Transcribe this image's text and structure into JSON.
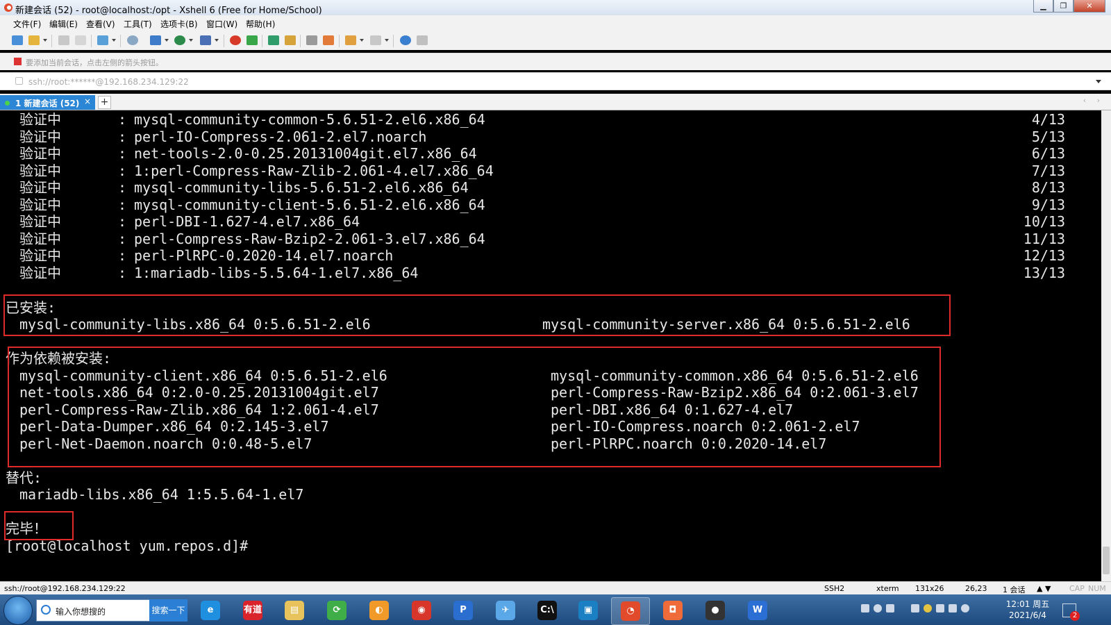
{
  "window": {
    "title": "新建会话 (52) - root@localhost:/opt - Xshell 6 (Free for Home/School)",
    "min": "▁",
    "max": "❐",
    "close": "✕"
  },
  "menu": [
    "文件(F)",
    "编辑(E)",
    "查看(V)",
    "工具(T)",
    "选项卡(B)",
    "窗口(W)",
    "帮助(H)"
  ],
  "hint": "要添加当前会话，点击左侧的箭头按钮。",
  "address": "ssh://root:******@192.168.234.129:22",
  "tab": {
    "label": "1 新建会话 (52)",
    "close": "×",
    "add": "+",
    "nav": "‹ ›"
  },
  "terminal": {
    "verify_label": "验证中",
    "colon": ":",
    "verify_rows": [
      {
        "pkg": "mysql-community-common-5.6.51-2.el6.x86_64",
        "num": "4/13"
      },
      {
        "pkg": "perl-IO-Compress-2.061-2.el7.noarch",
        "num": "5/13"
      },
      {
        "pkg": "net-tools-2.0-0.25.20131004git.el7.x86_64",
        "num": "6/13"
      },
      {
        "pkg": "1:perl-Compress-Raw-Zlib-2.061-4.el7.x86_64",
        "num": "7/13"
      },
      {
        "pkg": "mysql-community-libs-5.6.51-2.el6.x86_64",
        "num": "8/13"
      },
      {
        "pkg": "mysql-community-client-5.6.51-2.el6.x86_64",
        "num": "9/13"
      },
      {
        "pkg": "perl-DBI-1.627-4.el7.x86_64",
        "num": "10/13"
      },
      {
        "pkg": "perl-Compress-Raw-Bzip2-2.061-3.el7.x86_64",
        "num": "11/13"
      },
      {
        "pkg": "perl-PlRPC-0.2020-14.el7.noarch",
        "num": "12/13"
      },
      {
        "pkg": "1:mariadb-libs-5.5.64-1.el7.x86_64",
        "num": "13/13"
      }
    ],
    "installed_header": "已安装:",
    "installed": [
      "mysql-community-libs.x86_64 0:5.6.51-2.el6",
      "mysql-community-server.x86_64 0:5.6.51-2.el6"
    ],
    "deps_header": "作为依赖被安装:",
    "deps": [
      [
        "mysql-community-client.x86_64 0:5.6.51-2.el6",
        "mysql-community-common.x86_64 0:5.6.51-2.el6"
      ],
      [
        "net-tools.x86_64 0:2.0-0.25.20131004git.el7",
        "perl-Compress-Raw-Bzip2.x86_64 0:2.061-3.el7"
      ],
      [
        "perl-Compress-Raw-Zlib.x86_64 1:2.061-4.el7",
        "perl-DBI.x86_64 0:1.627-4.el7"
      ],
      [
        "perl-Data-Dumper.x86_64 0:2.145-3.el7",
        "perl-IO-Compress.noarch 0:2.061-2.el7"
      ],
      [
        "perl-Net-Daemon.noarch 0:0.48-5.el7",
        "perl-PlRPC.noarch 0:0.2020-14.el7"
      ]
    ],
    "replaced_header": "替代:",
    "replaced": "mariadb-libs.x86_64 1:5.5.64-1.el7",
    "complete": "完毕！",
    "prompt": "[root@localhost yum.repos.d]#"
  },
  "status": {
    "conn": "ssh://root@192.168.234.129:22",
    "proto": "SSH2",
    "term": "xterm",
    "size": "131x26",
    "cursor": "26,23",
    "sessions": "1 会话",
    "caps": "CAP",
    "num": "NUM"
  },
  "taskbar": {
    "search_placeholder": "输入你想搜的",
    "search_button": "搜索一下",
    "apps": [
      {
        "name": "ie-icon",
        "glyph": "e",
        "color": "#1f8fe0"
      },
      {
        "name": "youdao-icon",
        "glyph": "有道",
        "color": "#d9242b"
      },
      {
        "name": "file-explorer-icon",
        "glyph": "▤",
        "color": "#e8c25a"
      },
      {
        "name": "360-browser-icon",
        "glyph": "⟳",
        "color": "#3fae49"
      },
      {
        "name": "color-browser-icon",
        "glyph": "◐",
        "color": "#f19a2a"
      },
      {
        "name": "chrome-icon",
        "glyph": "◉",
        "color": "#d8362b"
      },
      {
        "name": "pycharm-icon",
        "glyph": "P",
        "color": "#2a6fd0"
      },
      {
        "name": "feishu-icon",
        "glyph": "✈",
        "color": "#5aa8e8"
      },
      {
        "name": "cmd-icon",
        "glyph": "C:\\",
        "color": "#111111"
      },
      {
        "name": "vmware-icon",
        "glyph": "▣",
        "color": "#1b7fc4"
      },
      {
        "name": "xshell-icon",
        "glyph": "◔",
        "color": "#e24a2c"
      },
      {
        "name": "presentation-icon",
        "glyph": "◘",
        "color": "#f06b3a"
      },
      {
        "name": "panda-icon",
        "glyph": "●",
        "color": "#333333"
      },
      {
        "name": "wps-icon",
        "glyph": "W",
        "color": "#2b6fd5"
      }
    ],
    "time": "12:01 周五",
    "date": "2021/6/4",
    "badge": "2"
  },
  "colors": {
    "terminal_bg": "#000000",
    "terminal_fg": "#e8e8e8",
    "highlight": "#e02b2b",
    "tab_active": "#2b86d6"
  }
}
